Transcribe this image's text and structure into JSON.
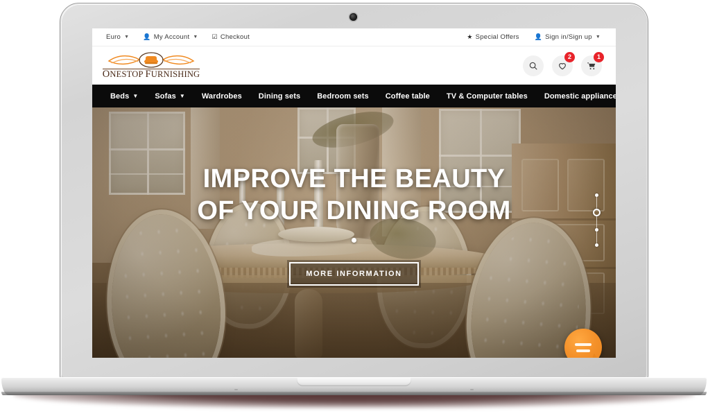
{
  "topbar": {
    "left_links": [
      {
        "label": "Euro",
        "icon": "",
        "caret": true
      },
      {
        "label": "My Account",
        "icon": "user-icon",
        "caret": true
      },
      {
        "label": "Checkout",
        "icon": "checkbox-check-icon",
        "caret": false
      }
    ],
    "right_links": [
      {
        "label": "Special Offers",
        "icon": "star-icon",
        "caret": false
      },
      {
        "label": "Sign in/Sign up",
        "icon": "user-icon",
        "caret": true
      }
    ]
  },
  "header": {
    "logo_text_first": "O",
    "logo_text_rest": "NESTOP ",
    "logo_text_second": "F",
    "logo_text_rest2": "URNISHING",
    "logo_full": "ONESTOP FURNISHING",
    "icons": [
      {
        "name": "search-icon",
        "badge": ""
      },
      {
        "name": "heart-icon",
        "badge": "2"
      },
      {
        "name": "cart-icon",
        "badge": "1"
      }
    ],
    "wishlist_badge": "2",
    "cart_badge": "1"
  },
  "nav": {
    "items": [
      {
        "label": "Beds",
        "caret": true
      },
      {
        "label": "Sofas",
        "caret": true
      },
      {
        "label": "Wardrobes",
        "caret": false
      },
      {
        "label": "Dining sets",
        "caret": false
      },
      {
        "label": "Bedroom sets",
        "caret": false
      },
      {
        "label": "Coffee table",
        "caret": false
      },
      {
        "label": "TV & Computer tables",
        "caret": false
      },
      {
        "label": "Domestic appliances",
        "caret": false
      }
    ]
  },
  "hero": {
    "title_line1": "IMPROVE THE BEAUTY",
    "title_line2": "OF YOUR DINING ROOM",
    "cta_label": "MORE INFORMATION",
    "slide_count": 4,
    "active_slide": 2
  },
  "chat": {
    "label": "chat-widget"
  },
  "colors": {
    "nav_background": "#0b0b0b",
    "badge_red": "#e8232a",
    "logo_brown": "#4a2a18",
    "logo_orange": "#f08a21",
    "chat_orange": "#f4912a"
  }
}
